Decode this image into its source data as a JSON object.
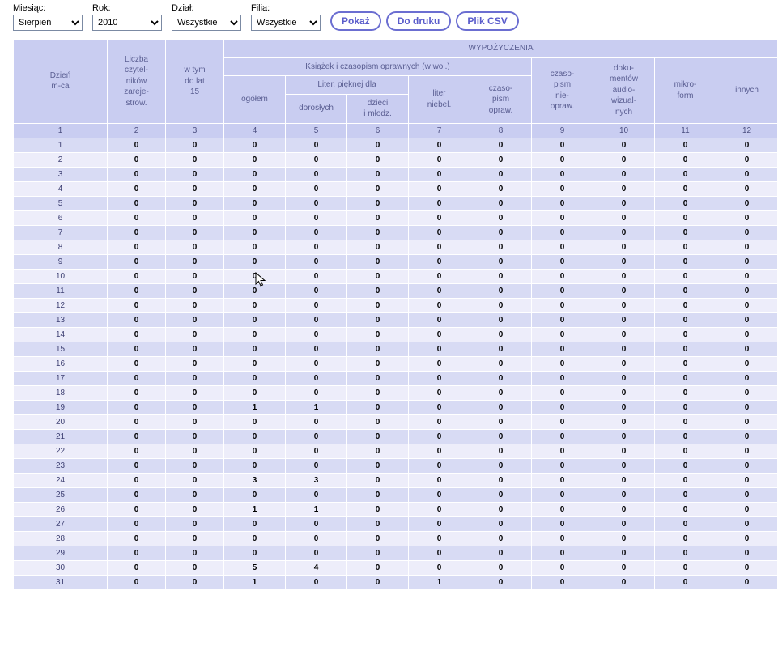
{
  "filters": {
    "month_label": "Miesiąc:",
    "month_value": "Sierpień",
    "year_label": "Rok:",
    "year_value": "2010",
    "dept_label": "Dział:",
    "dept_value": "Wszystkie",
    "branch_label": "Filia:",
    "branch_value": "Wszystkie"
  },
  "buttons": {
    "show": "Pokaż",
    "print": "Do druku",
    "csv": "Plik CSV"
  },
  "headers": {
    "day": "Dzień\nm-ca",
    "readers": "Liczba\nczytel-\nników\nzareje-\nstrow.",
    "under15": "w tym\ndo lat\n15",
    "loans_top": "WYPOŻYCZENIA",
    "books_bound": "Książek i czasopism oprawnych (w wol.)",
    "total": "ogółem",
    "fiction_for": "Liter. pięknej dla",
    "adults": "dorosłych",
    "children": "dzieci\ni młodz.",
    "nonfiction": "liter\nniebel.",
    "periodicals_bound": "czaso-\npism\nopraw.",
    "periodicals_unbound": "czaso-\npism\nnie-\nopraw.",
    "audiovisual": "doku-\nmentów\naudio-\nwizual-\nnych",
    "microforms": "mikro-\nform",
    "other": "innych"
  },
  "column_indices": [
    "1",
    "2",
    "3",
    "4",
    "5",
    "6",
    "7",
    "8",
    "9",
    "10",
    "11",
    "12"
  ],
  "rows": [
    {
      "day": "1",
      "v": [
        "0",
        "0",
        "0",
        "0",
        "0",
        "0",
        "0",
        "0",
        "0",
        "0",
        "0"
      ]
    },
    {
      "day": "2",
      "v": [
        "0",
        "0",
        "0",
        "0",
        "0",
        "0",
        "0",
        "0",
        "0",
        "0",
        "0"
      ]
    },
    {
      "day": "3",
      "v": [
        "0",
        "0",
        "0",
        "0",
        "0",
        "0",
        "0",
        "0",
        "0",
        "0",
        "0"
      ]
    },
    {
      "day": "4",
      "v": [
        "0",
        "0",
        "0",
        "0",
        "0",
        "0",
        "0",
        "0",
        "0",
        "0",
        "0"
      ]
    },
    {
      "day": "5",
      "v": [
        "0",
        "0",
        "0",
        "0",
        "0",
        "0",
        "0",
        "0",
        "0",
        "0",
        "0"
      ]
    },
    {
      "day": "6",
      "v": [
        "0",
        "0",
        "0",
        "0",
        "0",
        "0",
        "0",
        "0",
        "0",
        "0",
        "0"
      ]
    },
    {
      "day": "7",
      "v": [
        "0",
        "0",
        "0",
        "0",
        "0",
        "0",
        "0",
        "0",
        "0",
        "0",
        "0"
      ]
    },
    {
      "day": "8",
      "v": [
        "0",
        "0",
        "0",
        "0",
        "0",
        "0",
        "0",
        "0",
        "0",
        "0",
        "0"
      ]
    },
    {
      "day": "9",
      "v": [
        "0",
        "0",
        "0",
        "0",
        "0",
        "0",
        "0",
        "0",
        "0",
        "0",
        "0"
      ]
    },
    {
      "day": "10",
      "v": [
        "0",
        "0",
        "0",
        "0",
        "0",
        "0",
        "0",
        "0",
        "0",
        "0",
        "0"
      ]
    },
    {
      "day": "11",
      "v": [
        "0",
        "0",
        "0",
        "0",
        "0",
        "0",
        "0",
        "0",
        "0",
        "0",
        "0"
      ]
    },
    {
      "day": "12",
      "v": [
        "0",
        "0",
        "0",
        "0",
        "0",
        "0",
        "0",
        "0",
        "0",
        "0",
        "0"
      ]
    },
    {
      "day": "13",
      "v": [
        "0",
        "0",
        "0",
        "0",
        "0",
        "0",
        "0",
        "0",
        "0",
        "0",
        "0"
      ]
    },
    {
      "day": "14",
      "v": [
        "0",
        "0",
        "0",
        "0",
        "0",
        "0",
        "0",
        "0",
        "0",
        "0",
        "0"
      ]
    },
    {
      "day": "15",
      "v": [
        "0",
        "0",
        "0",
        "0",
        "0",
        "0",
        "0",
        "0",
        "0",
        "0",
        "0"
      ]
    },
    {
      "day": "16",
      "v": [
        "0",
        "0",
        "0",
        "0",
        "0",
        "0",
        "0",
        "0",
        "0",
        "0",
        "0"
      ]
    },
    {
      "day": "17",
      "v": [
        "0",
        "0",
        "0",
        "0",
        "0",
        "0",
        "0",
        "0",
        "0",
        "0",
        "0"
      ]
    },
    {
      "day": "18",
      "v": [
        "0",
        "0",
        "0",
        "0",
        "0",
        "0",
        "0",
        "0",
        "0",
        "0",
        "0"
      ]
    },
    {
      "day": "19",
      "v": [
        "0",
        "0",
        "1",
        "1",
        "0",
        "0",
        "0",
        "0",
        "0",
        "0",
        "0"
      ]
    },
    {
      "day": "20",
      "v": [
        "0",
        "0",
        "0",
        "0",
        "0",
        "0",
        "0",
        "0",
        "0",
        "0",
        "0"
      ]
    },
    {
      "day": "21",
      "v": [
        "0",
        "0",
        "0",
        "0",
        "0",
        "0",
        "0",
        "0",
        "0",
        "0",
        "0"
      ]
    },
    {
      "day": "22",
      "v": [
        "0",
        "0",
        "0",
        "0",
        "0",
        "0",
        "0",
        "0",
        "0",
        "0",
        "0"
      ]
    },
    {
      "day": "23",
      "v": [
        "0",
        "0",
        "0",
        "0",
        "0",
        "0",
        "0",
        "0",
        "0",
        "0",
        "0"
      ]
    },
    {
      "day": "24",
      "v": [
        "0",
        "0",
        "3",
        "3",
        "0",
        "0",
        "0",
        "0",
        "0",
        "0",
        "0"
      ]
    },
    {
      "day": "25",
      "v": [
        "0",
        "0",
        "0",
        "0",
        "0",
        "0",
        "0",
        "0",
        "0",
        "0",
        "0"
      ]
    },
    {
      "day": "26",
      "v": [
        "0",
        "0",
        "1",
        "1",
        "0",
        "0",
        "0",
        "0",
        "0",
        "0",
        "0"
      ]
    },
    {
      "day": "27",
      "v": [
        "0",
        "0",
        "0",
        "0",
        "0",
        "0",
        "0",
        "0",
        "0",
        "0",
        "0"
      ]
    },
    {
      "day": "28",
      "v": [
        "0",
        "0",
        "0",
        "0",
        "0",
        "0",
        "0",
        "0",
        "0",
        "0",
        "0"
      ]
    },
    {
      "day": "29",
      "v": [
        "0",
        "0",
        "0",
        "0",
        "0",
        "0",
        "0",
        "0",
        "0",
        "0",
        "0"
      ]
    },
    {
      "day": "30",
      "v": [
        "0",
        "0",
        "5",
        "4",
        "0",
        "0",
        "0",
        "0",
        "0",
        "0",
        "0"
      ]
    },
    {
      "day": "31",
      "v": [
        "0",
        "0",
        "1",
        "0",
        "0",
        "1",
        "0",
        "0",
        "0",
        "0",
        "0"
      ]
    }
  ]
}
